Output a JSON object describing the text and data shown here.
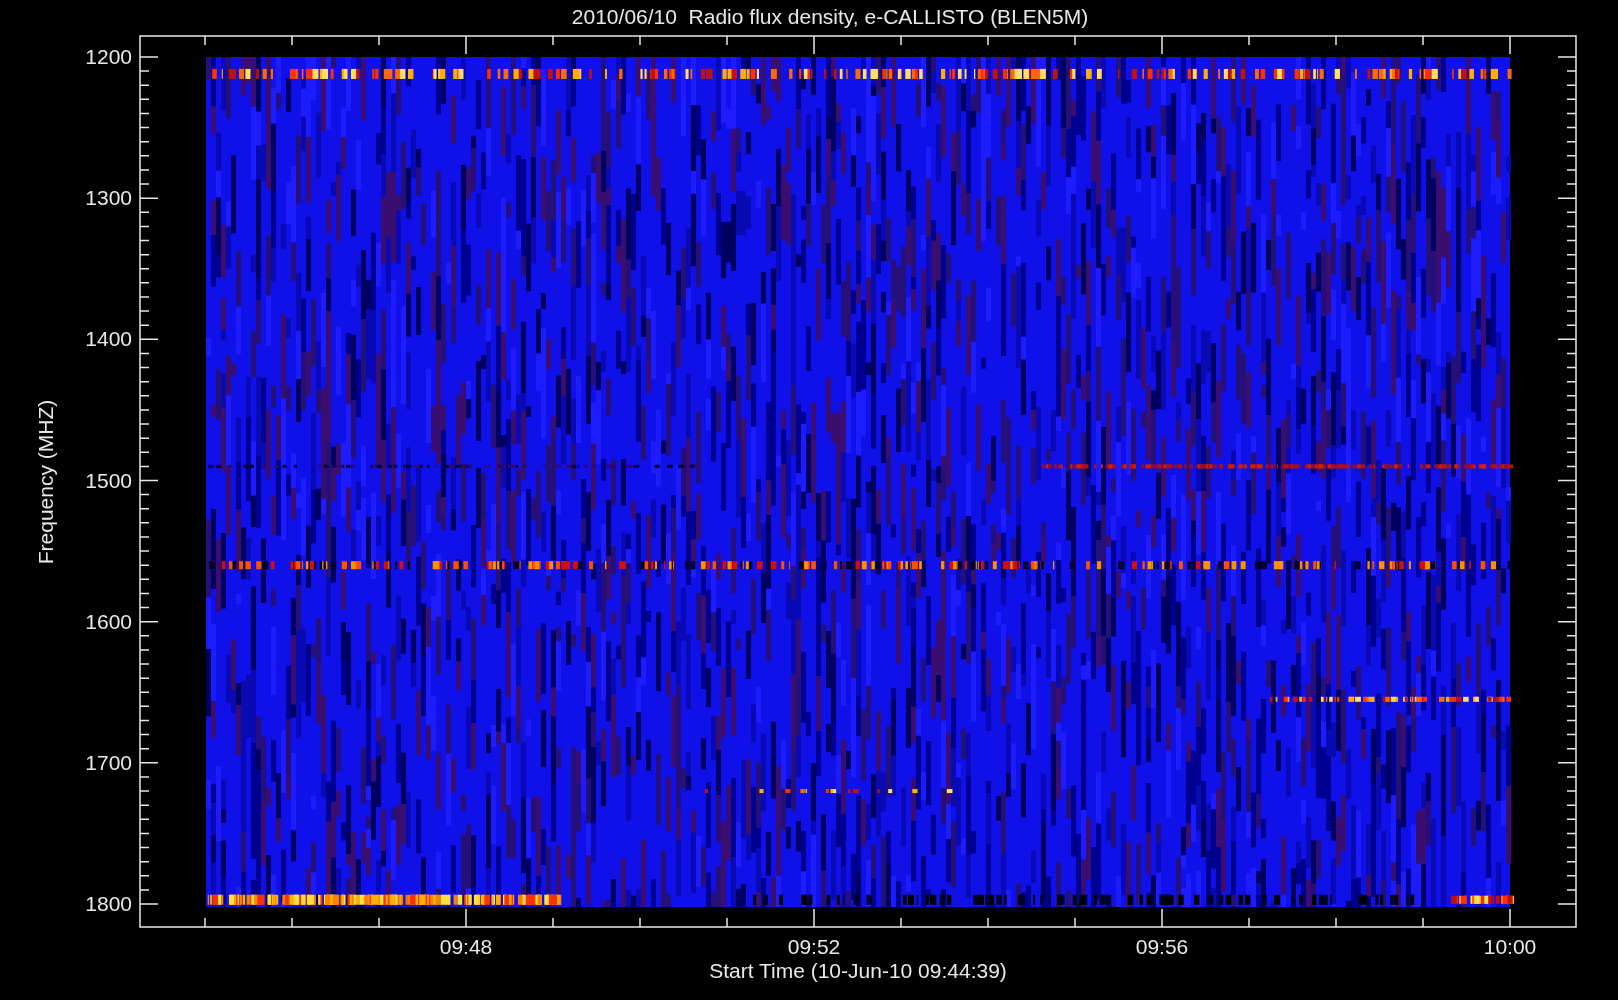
{
  "title": "2010/06/10  Radio flux density, e-CALLISTO (BLEN5M)",
  "y_axis": {
    "label": "Frequency (MHZ)",
    "ticks": [
      "1200",
      "1300",
      "1400",
      "1500",
      "1600",
      "1700",
      "1800"
    ]
  },
  "x_axis": {
    "label": "Start Time (10-Jun-10 09:44:39)",
    "ticks": [
      "09:48",
      "09:52",
      "09:56",
      "10:00"
    ]
  }
}
